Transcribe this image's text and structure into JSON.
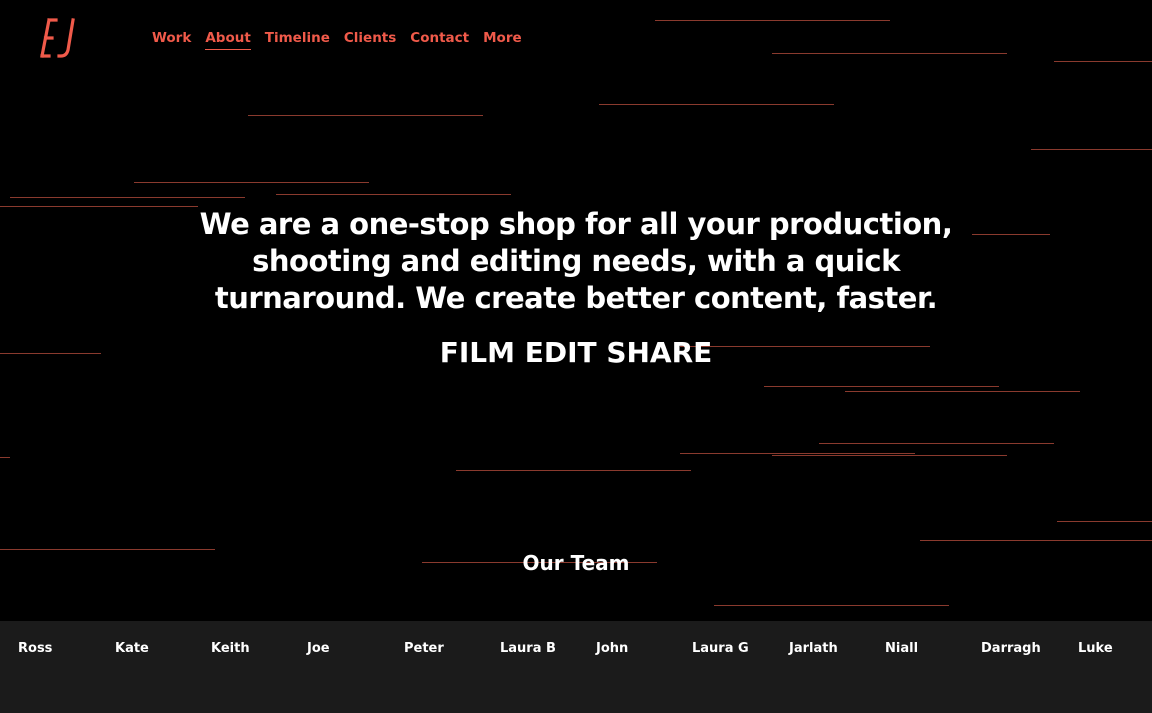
{
  "brand": {
    "logo_text": "EJ",
    "accent_color": "#f05a4a",
    "streak_color": "#8a3a2e"
  },
  "nav": {
    "items": [
      {
        "label": "Work"
      },
      {
        "label": "About",
        "active": true
      },
      {
        "label": "Timeline"
      },
      {
        "label": "Clients"
      },
      {
        "label": "Contact"
      },
      {
        "label": "More"
      }
    ]
  },
  "hero": {
    "text": "We are a one-stop shop for all your production, shooting and editing needs, with a quick turnaround. We create better content, faster.",
    "tagline": "FILM EDIT SHARE"
  },
  "team": {
    "title": "Our Team",
    "members": [
      "Ross",
      "Kate",
      "Keith",
      "Joe",
      "Peter",
      "Laura B",
      "John",
      "Laura G",
      "Jarlath",
      "Niall",
      "Darragh",
      "Luke"
    ]
  }
}
